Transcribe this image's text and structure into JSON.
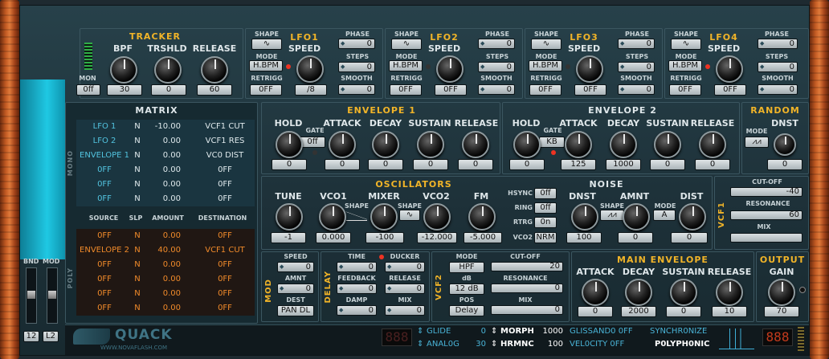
{
  "tracker": {
    "title": "TRACKER",
    "bpf": "BPF",
    "trshld": "TRSHLD",
    "release": "RELEASE",
    "mon": "MON",
    "mon_val": "0ff",
    "bpf_val": "30",
    "trshld_val": "0",
    "release_val": "60"
  },
  "lfos": [
    {
      "title": "LFO1",
      "shape": "SHAPE",
      "speed": "SPEED",
      "phase": "PHASE",
      "phase_val": "0",
      "mode": "MODE",
      "mode_val": "H.BPM",
      "steps": "STEPS",
      "steps_val": "0",
      "retrigg": "RETRIGG",
      "retrigg_val": "0FF",
      "speed_val": "/8",
      "smooth": "SMOOTH",
      "smooth_val": "0"
    },
    {
      "title": "LFO2",
      "shape": "SHAPE",
      "speed": "SPEED",
      "phase": "PHASE",
      "phase_val": "0",
      "mode": "MODE",
      "mode_val": "H.BPM",
      "steps": "STEPS",
      "steps_val": "0",
      "retrigg": "RETRIGG",
      "retrigg_val": "0FF",
      "speed_val": "0FF",
      "smooth": "SMOOTH",
      "smooth_val": "0"
    },
    {
      "title": "LFO3",
      "shape": "SHAPE",
      "speed": "SPEED",
      "phase": "PHASE",
      "phase_val": "0",
      "mode": "MODE",
      "mode_val": "H.BPM",
      "steps": "STEPS",
      "steps_val": "0",
      "retrigg": "RETRIGG",
      "retrigg_val": "0FF",
      "speed_val": "0FF",
      "smooth": "SMOOTH",
      "smooth_val": "0"
    },
    {
      "title": "LFO4",
      "shape": "SHAPE",
      "speed": "SPEED",
      "phase": "PHASE",
      "phase_val": "0",
      "mode": "MODE",
      "mode_val": "H.BPM",
      "steps": "STEPS",
      "steps_val": "0",
      "retrigg": "RETRIGG",
      "retrigg_val": "0FF",
      "speed_val": "0FF",
      "smooth": "SMOOTH",
      "smooth_val": "0"
    }
  ],
  "matrix": {
    "title": "MATRIX",
    "mono": "MONO",
    "poly": "POLY",
    "headers": [
      "SOURCE",
      "SLP",
      "AMOUNT",
      "DESTINATION"
    ],
    "mono_rows": [
      [
        "LFO 1",
        "N",
        "-10.00",
        "VCF1 CUT"
      ],
      [
        "LFO 2",
        "N",
        "0.00",
        "VCF1 RES"
      ],
      [
        "ENVELOPE 1",
        "N",
        "0.00",
        "VC0 DIST"
      ],
      [
        "0FF",
        "N",
        "0.00",
        "0FF"
      ],
      [
        "0FF",
        "N",
        "0.00",
        "0FF"
      ],
      [
        "0FF",
        "N",
        "0.00",
        "0FF"
      ]
    ],
    "poly_rows": [
      [
        "0FF",
        "N",
        "0.00",
        "0FF"
      ],
      [
        "ENVELOPE 2",
        "N",
        "40.00",
        "VCF1 CUT"
      ],
      [
        "0FF",
        "N",
        "0.00",
        "0FF"
      ],
      [
        "0FF",
        "N",
        "0.00",
        "0FF"
      ],
      [
        "0FF",
        "N",
        "0.00",
        "0FF"
      ],
      [
        "0FF",
        "N",
        "0.00",
        "0FF"
      ]
    ]
  },
  "env1": {
    "title": "ENVELOPE 1",
    "hold": "HOLD",
    "gate": "GATE",
    "gate_val": "0ff",
    "attack": "ATTACK",
    "decay": "DECAY",
    "sustain": "SUSTAIN",
    "release": "RELEASE",
    "vals": [
      "0",
      "0",
      "0",
      "0",
      "0"
    ]
  },
  "env2": {
    "title": "ENVELOPE 2",
    "hold": "HOLD",
    "gate": "GATE",
    "gate_val": "KB",
    "attack": "ATTACK",
    "decay": "DECAY",
    "sustain": "SUSTAIN",
    "release": "RELEASE",
    "vals": [
      "0",
      "125",
      "1000",
      "0",
      "0"
    ]
  },
  "random": {
    "title": "RANDOM",
    "dnst": "DNST",
    "mode": "MODE",
    "dnst_val": "0"
  },
  "osc": {
    "title": "OSCILLATORS",
    "tune": "TUNE",
    "vco1": "VCO1",
    "mixer": "MIXER",
    "vco2": "VCO2",
    "fm": "FM",
    "shape": "SHAPE",
    "vals": [
      "-1",
      "0.000",
      "-100",
      "-12.000",
      "-5.000"
    ],
    "hsync": "HSYNC",
    "hsync_val": "0ff",
    "ring": "RING",
    "ring_val": "0ff",
    "rtrg": "RTRG",
    "rtrg_val": "0n",
    "vco2_val": "NRM"
  },
  "noise": {
    "title": "NOISE",
    "dnst": "DNST",
    "shape": "SHAPE",
    "amnt": "AMNT",
    "mode": "MODE",
    "mode_val": "A",
    "dist": "DIST",
    "vals": [
      "100",
      "0",
      "0"
    ]
  },
  "vcf1": {
    "label": "VCF1",
    "cutoff": "CUT-OFF",
    "cutoff_val": "-40",
    "resonance": "RESONANCE",
    "resonance_val": "60",
    "mix": "MIX"
  },
  "mod": {
    "label": "MOD",
    "speed": "SPEED",
    "speed_val": "0",
    "amnt": "AMNT",
    "amnt_val": "0",
    "dest": "DEST",
    "dest_val": "PAN DL"
  },
  "delay": {
    "label": "DELAY",
    "time": "TIME",
    "time_val": "0",
    "ducker": "DUCKER",
    "ducker_val": "0",
    "feedback": "FEEDBACK",
    "feedback_val": "0",
    "release": "RELEASE",
    "release_val": "0",
    "damp": "DAMP",
    "damp_val": "0",
    "mix": "MIX",
    "mix_val": "0"
  },
  "vcf2": {
    "label": "VCF2",
    "mode": "MODE",
    "mode_val": "HPF",
    "cutoff": "CUT-OFF",
    "cutoff_val": "20",
    "db": "dB",
    "db_val": "12 dB",
    "resonance": "RESONANCE",
    "resonance_val": "0",
    "pos": "POS",
    "pos_val": "Delay",
    "mix": "MIX",
    "mix_val": "0"
  },
  "main_env": {
    "title": "MAIN ENVELOPE",
    "attack": "ATTACK",
    "decay": "DECAY",
    "sustain": "SUSTAIN",
    "release": "RELEASE",
    "vals": [
      "0",
      "2000",
      "0",
      "10"
    ]
  },
  "output": {
    "title": "OUTPUT",
    "gain": "GAIN",
    "gain_val": "70"
  },
  "side": {
    "bnd": "BND",
    "mod": "MOD",
    "b1": "12",
    "b2": "L2"
  },
  "brand": {
    "name": "QUACK",
    "url": "WWW.NOVAFLASH.COM"
  },
  "bottom": {
    "disp1": "888",
    "glide": "GLIDE",
    "glide_val": "0",
    "analog": "ANAL0G",
    "analog_val": "30",
    "morph": "MORPH",
    "morph_val": "1000",
    "hrmnc": "HRMNC",
    "hrmnc_val": "100",
    "glissando": "GLISSAND0 0FF",
    "velocity": "VEL0CITY 0FF",
    "synchronize": "SYNCHR0NIZE",
    "polyphonic": "P0LYPH0NIC",
    "disp2": "888"
  },
  "colors": {
    "accent": "#f1b428",
    "cyan": "#1fc8e3",
    "matrix_orange": "#f08a2a",
    "led": "#e32"
  }
}
